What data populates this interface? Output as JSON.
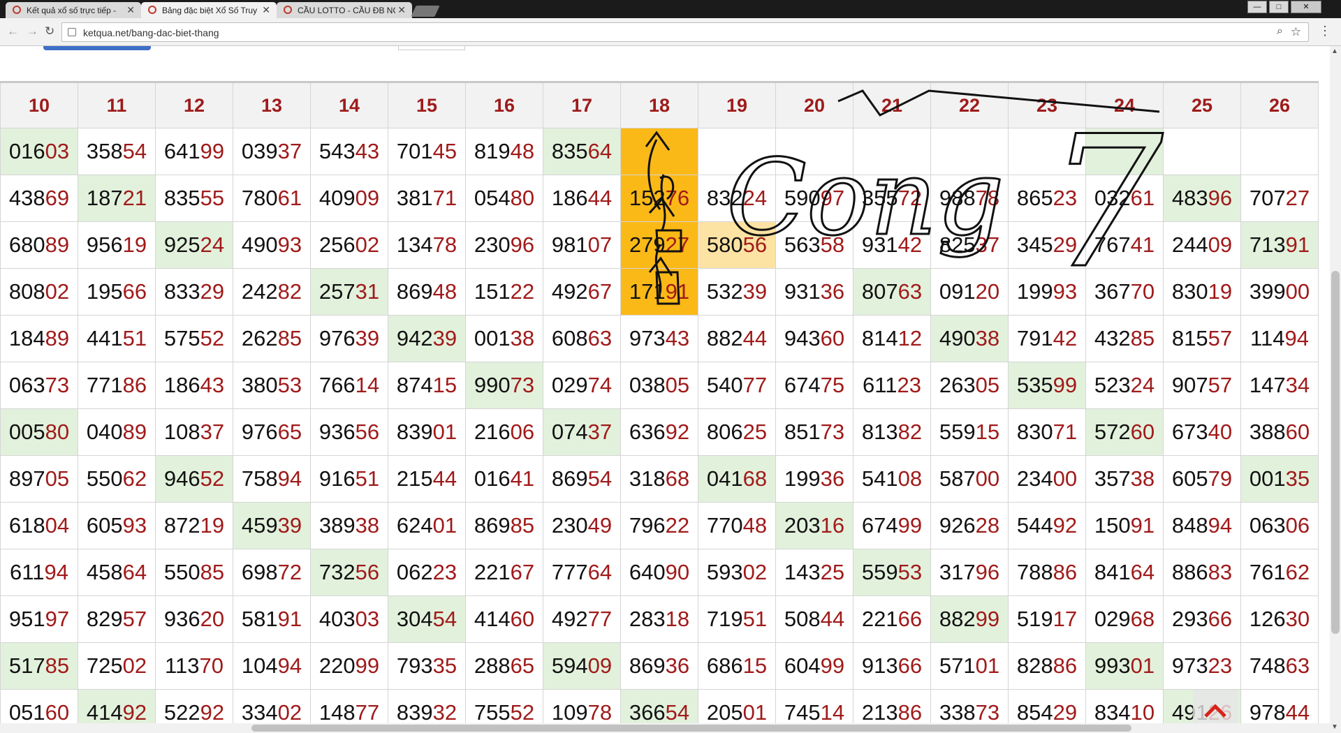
{
  "browser": {
    "tabs": [
      {
        "title": "Kết quả xổ số trực tiếp -",
        "active": false
      },
      {
        "title": "Bảng đặc biệt Xổ Số Truy",
        "active": true
      },
      {
        "title": "CẦU LOTTO - CẦU ĐB NO",
        "active": false
      }
    ],
    "close_glyph": "✕",
    "url": "ketqua.net/bang-dac-biet-thang"
  },
  "handwriting": {
    "word": "Cong",
    "digit": "7"
  },
  "table": {
    "columns": [
      "10",
      "11",
      "12",
      "13",
      "14",
      "15",
      "16",
      "17",
      "18",
      "19",
      "20",
      "21",
      "22",
      "23",
      "24",
      "25",
      "26"
    ],
    "rows": [
      [
        "01603",
        "35854",
        "64199",
        "03937",
        "54343",
        "70145",
        "81948",
        "83564",
        "",
        "",
        "",
        "",
        "",
        "",
        "",
        "",
        ""
      ],
      [
        "43869",
        "18721",
        "83555",
        "78061",
        "40909",
        "38171",
        "05480",
        "18644",
        "15276",
        "83224",
        "59097",
        "35572",
        "98878",
        "86523",
        "03261",
        "48396",
        "70727"
      ],
      [
        "68089",
        "95619",
        "92524",
        "49093",
        "25602",
        "13478",
        "23096",
        "98107",
        "27927",
        "58056",
        "56358",
        "93142",
        "82537",
        "34529",
        "76741",
        "24409",
        "71391"
      ],
      [
        "80802",
        "19566",
        "83329",
        "24282",
        "25731",
        "86948",
        "15122",
        "49267",
        "17191",
        "53239",
        "93136",
        "80763",
        "09120",
        "19993",
        "36770",
        "83019",
        "39900"
      ],
      [
        "18489",
        "44151",
        "57552",
        "26285",
        "97639",
        "94239",
        "00138",
        "60863",
        "97343",
        "88244",
        "94360",
        "81412",
        "49038",
        "79142",
        "43285",
        "81557",
        "11494"
      ],
      [
        "06373",
        "77186",
        "18643",
        "38053",
        "76614",
        "87415",
        "99073",
        "02974",
        "03805",
        "54077",
        "67475",
        "61123",
        "26305",
        "53599",
        "52324",
        "90757",
        "14734"
      ],
      [
        "00580",
        "04089",
        "10837",
        "97665",
        "93656",
        "83901",
        "21606",
        "07437",
        "63692",
        "80625",
        "85173",
        "81382",
        "55915",
        "83071",
        "57260",
        "67340",
        "38860"
      ],
      [
        "89705",
        "55062",
        "94652",
        "75894",
        "91651",
        "21544",
        "01641",
        "86954",
        "31868",
        "04168",
        "19936",
        "54108",
        "58700",
        "23400",
        "35738",
        "60579",
        "00135"
      ],
      [
        "61804",
        "60593",
        "87219",
        "45939",
        "38938",
        "62401",
        "86985",
        "23049",
        "79622",
        "77048",
        "20316",
        "67499",
        "92628",
        "54492",
        "15091",
        "84894",
        "06306"
      ],
      [
        "61194",
        "45864",
        "55085",
        "69872",
        "73256",
        "06223",
        "22167",
        "77764",
        "64090",
        "59302",
        "14325",
        "55953",
        "31796",
        "78886",
        "84164",
        "88683",
        "76162"
      ],
      [
        "95197",
        "82957",
        "93620",
        "58191",
        "40303",
        "30454",
        "41460",
        "49277",
        "28318",
        "71951",
        "50844",
        "22166",
        "88299",
        "51917",
        "02968",
        "29366",
        "12630"
      ],
      [
        "51785",
        "72502",
        "11370",
        "10494",
        "22099",
        "79335",
        "28865",
        "59409",
        "86936",
        "68615",
        "60499",
        "91366",
        "57101",
        "82886",
        "99301",
        "97323",
        "74863"
      ],
      [
        "05160",
        "41492",
        "52292",
        "33402",
        "14877",
        "83932",
        "75552",
        "10978",
        "36654",
        "20501",
        "74514",
        "21386",
        "33873",
        "85429",
        "83410",
        "49126",
        "97844"
      ]
    ],
    "highlights": {
      "green": [
        [
          0,
          0
        ],
        [
          0,
          7
        ],
        [
          1,
          1
        ],
        [
          1,
          15
        ],
        [
          2,
          2
        ],
        [
          2,
          16
        ],
        [
          3,
          4
        ],
        [
          3,
          11
        ],
        [
          4,
          5
        ],
        [
          4,
          12
        ],
        [
          5,
          6
        ],
        [
          5,
          13
        ],
        [
          6,
          0
        ],
        [
          6,
          7
        ],
        [
          6,
          14
        ],
        [
          7,
          2
        ],
        [
          7,
          9
        ],
        [
          7,
          16
        ],
        [
          8,
          3
        ],
        [
          8,
          10
        ],
        [
          9,
          4
        ],
        [
          9,
          11
        ],
        [
          10,
          5
        ],
        [
          10,
          12
        ],
        [
          11,
          0
        ],
        [
          11,
          7
        ],
        [
          11,
          14
        ],
        [
          12,
          1
        ],
        [
          12,
          8
        ],
        [
          12,
          15
        ],
        [
          0,
          14
        ]
      ],
      "orange": [
        [
          0,
          8
        ],
        [
          1,
          8
        ],
        [
          2,
          8
        ],
        [
          3,
          8
        ]
      ],
      "light_orange": [
        [
          2,
          9
        ]
      ]
    }
  },
  "colors": {
    "accent": "#9e1b1b",
    "green_cell": "#e2f1dc",
    "orange_cell": "#fbb917"
  }
}
